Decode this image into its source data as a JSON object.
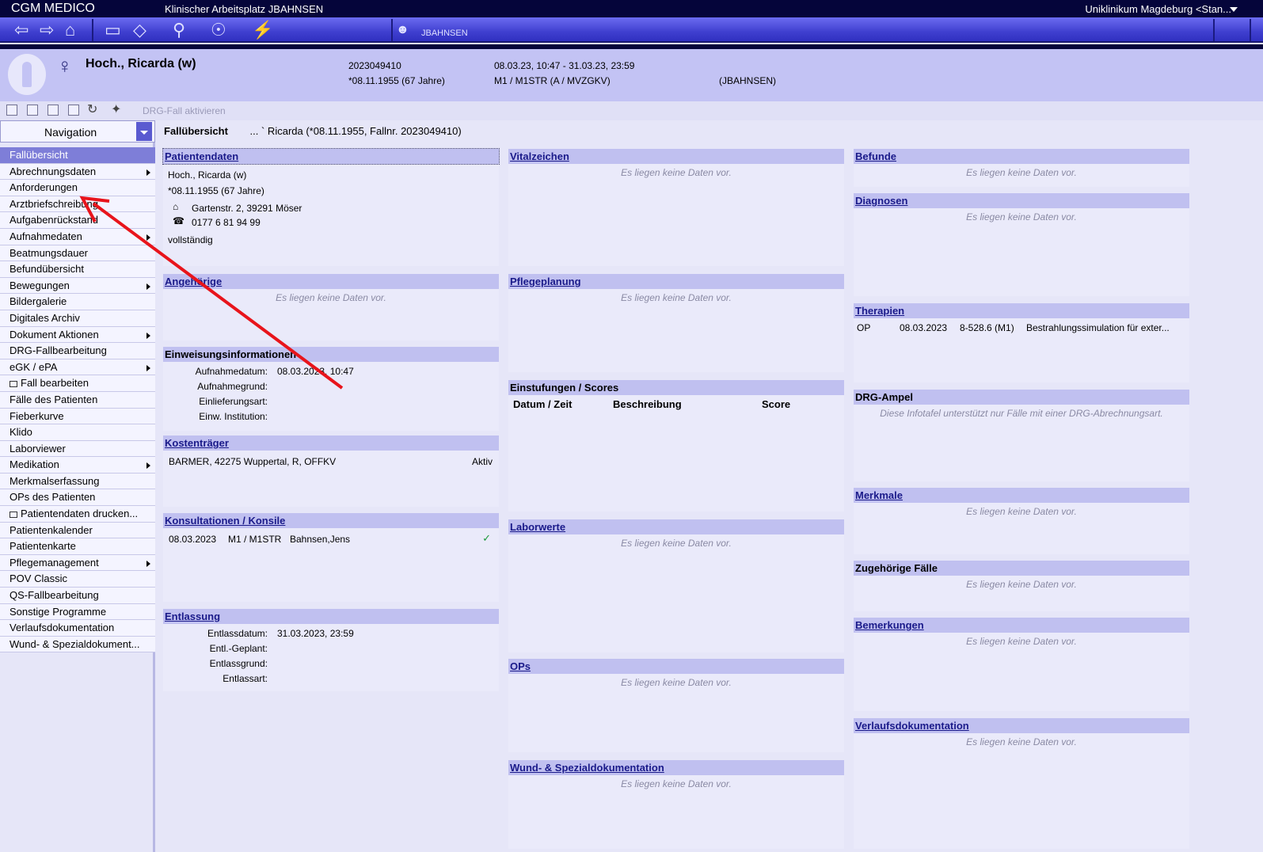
{
  "titlebar": {
    "app_name": "CGM MEDICO",
    "workspace": "Klinischer Arbeitsplatz JBAHNSEN",
    "location": "Uniklinikum Magdeburg <Stan..."
  },
  "toolbar": {
    "user_label": "JBAHNSEN",
    "icons": [
      "back-arrow-icon",
      "forward-arrow-icon",
      "home-icon",
      "exit-icon",
      "document-icon",
      "search-icon",
      "patient-admit-icon",
      "lightning-icon",
      "user-card-icon"
    ]
  },
  "patient": {
    "name": "Hoch., Ricarda (w)",
    "case_no": "2023049410",
    "birth": "*08.11.1955 (67 Jahre)",
    "period": "08.03.23, 10:47 - 31.03.23, 23:59",
    "ward": "M1 / M1STR  (A / MVZGKV)",
    "user": "(JBAHNSEN)"
  },
  "subtoolbar": {
    "drg_label": "DRG-Fall aktivieren"
  },
  "navigation": {
    "title": "Navigation",
    "items": [
      {
        "label": "Fallübersicht",
        "active": true,
        "submenu": false,
        "window": false
      },
      {
        "label": "Abrechnungsdaten",
        "active": false,
        "submenu": true,
        "window": false
      },
      {
        "label": "Anforderungen",
        "active": false,
        "submenu": false,
        "window": false
      },
      {
        "label": "Arztbriefschreibung",
        "active": false,
        "submenu": false,
        "window": false
      },
      {
        "label": "Aufgabenrückstand",
        "active": false,
        "submenu": false,
        "window": false
      },
      {
        "label": "Aufnahmedaten",
        "active": false,
        "submenu": true,
        "window": false
      },
      {
        "label": "Beatmungsdauer",
        "active": false,
        "submenu": false,
        "window": false
      },
      {
        "label": "Befundübersicht",
        "active": false,
        "submenu": false,
        "window": false
      },
      {
        "label": "Bewegungen",
        "active": false,
        "submenu": true,
        "window": false
      },
      {
        "label": "Bildergalerie",
        "active": false,
        "submenu": false,
        "window": false
      },
      {
        "label": "Digitales Archiv",
        "active": false,
        "submenu": false,
        "window": false
      },
      {
        "label": "Dokument Aktionen",
        "active": false,
        "submenu": true,
        "window": false
      },
      {
        "label": "DRG-Fallbearbeitung",
        "active": false,
        "submenu": false,
        "window": false
      },
      {
        "label": "eGK / ePA",
        "active": false,
        "submenu": true,
        "window": false
      },
      {
        "label": "Fall bearbeiten",
        "active": false,
        "submenu": false,
        "window": true
      },
      {
        "label": "Fälle des Patienten",
        "active": false,
        "submenu": false,
        "window": false
      },
      {
        "label": "Fieberkurve",
        "active": false,
        "submenu": false,
        "window": false
      },
      {
        "label": "Klido",
        "active": false,
        "submenu": false,
        "window": false
      },
      {
        "label": "Laborviewer",
        "active": false,
        "submenu": false,
        "window": false
      },
      {
        "label": "Medikation",
        "active": false,
        "submenu": true,
        "window": false
      },
      {
        "label": "Merkmalserfassung",
        "active": false,
        "submenu": false,
        "window": false
      },
      {
        "label": "OPs des Patienten",
        "active": false,
        "submenu": false,
        "window": false
      },
      {
        "label": "Patientendaten drucken...",
        "active": false,
        "submenu": false,
        "window": true
      },
      {
        "label": "Patientenkalender",
        "active": false,
        "submenu": false,
        "window": false
      },
      {
        "label": "Patientenkarte",
        "active": false,
        "submenu": false,
        "window": false
      },
      {
        "label": "Pflegemanagement",
        "active": false,
        "submenu": true,
        "window": false
      },
      {
        "label": "POV Classic",
        "active": false,
        "submenu": false,
        "window": false
      },
      {
        "label": "QS-Fallbearbeitung",
        "active": false,
        "submenu": false,
        "window": false
      },
      {
        "label": "Sonstige Programme",
        "active": false,
        "submenu": false,
        "window": false
      },
      {
        "label": "Verlaufsdokumentation",
        "active": false,
        "submenu": false,
        "window": false
      },
      {
        "label": "Wund- & Spezialdokument...",
        "active": false,
        "submenu": false,
        "window": false
      }
    ]
  },
  "overview": {
    "title": "Fallübersicht",
    "subtitle": "... ` Ricarda (*08.11.1955, Fallnr. 2023049410)"
  },
  "no_data": "Es liegen keine Daten vor.",
  "panels": {
    "patientendaten": {
      "title": "Patientendaten",
      "name": "Hoch., Ricarda (w)",
      "birth": "*08.11.1955 (67 Jahre)",
      "address": "Gartenstr. 2, 39291 Möser",
      "phone": "0177  6 81 94 99",
      "status": "vollständig"
    },
    "angehoerige": {
      "title": "Angehörige"
    },
    "einweisung": {
      "title": "Einweisungsinformationen",
      "lbl_aufnahmedatum": "Aufnahmedatum:",
      "val_aufnahmedatum": "08.03.2023, 10:47",
      "lbl_aufnahmegrund": "Aufnahmegrund:",
      "lbl_einlieferungsart": "Einlieferungsart:",
      "lbl_institution": "Einw. Institution:"
    },
    "kostentraeger": {
      "title": "Kostenträger",
      "insurer": "BARMER, 42275 Wuppertal, R, OFFKV",
      "status": "Aktiv"
    },
    "konsultationen": {
      "title": "Konsultationen / Konsile",
      "date": "08.03.2023",
      "ward": "M1 / M1STR",
      "doctor": "Bahnsen,Jens"
    },
    "entlassung": {
      "title": "Entlassung",
      "lbl_datum": "Entlassdatum:",
      "val_datum": "31.03.2023, 23:59",
      "lbl_geplant": "Entl.-Geplant:",
      "lbl_grund": "Entlassgrund:",
      "lbl_art": "Entlassart:"
    },
    "vitalzeichen": {
      "title": "Vitalzeichen"
    },
    "pflegeplanung": {
      "title": "Pflegeplanung"
    },
    "einstufungen": {
      "title": "Einstufungen / Scores",
      "col_datum": "Datum / Zeit",
      "col_beschreibung": "Beschreibung",
      "col_score": "Score"
    },
    "laborwerte": {
      "title": "Laborwerte"
    },
    "ops": {
      "title": "OPs"
    },
    "wund": {
      "title": "Wund- & Spezialdokumentation"
    },
    "befunde": {
      "title": "Befunde"
    },
    "diagnosen": {
      "title": "Diagnosen"
    },
    "therapien": {
      "title": "Therapien",
      "type": "OP",
      "date": "08.03.2023",
      "code": "8-528.6 (M1)",
      "desc": "Bestrahlungssimulation für exter..."
    },
    "drg_ampel": {
      "title": "DRG-Ampel",
      "info": "Diese Infotafel unterstützt nur Fälle mit einer DRG-Abrechnungsart."
    },
    "merkmale": {
      "title": "Merkmale"
    },
    "zugehoerige": {
      "title": "Zugehörige Fälle"
    },
    "bemerkungen": {
      "title": "Bemerkungen"
    },
    "verlauf": {
      "title": "Verlaufsdokumentation"
    }
  },
  "annotation_color": "#e8141b"
}
